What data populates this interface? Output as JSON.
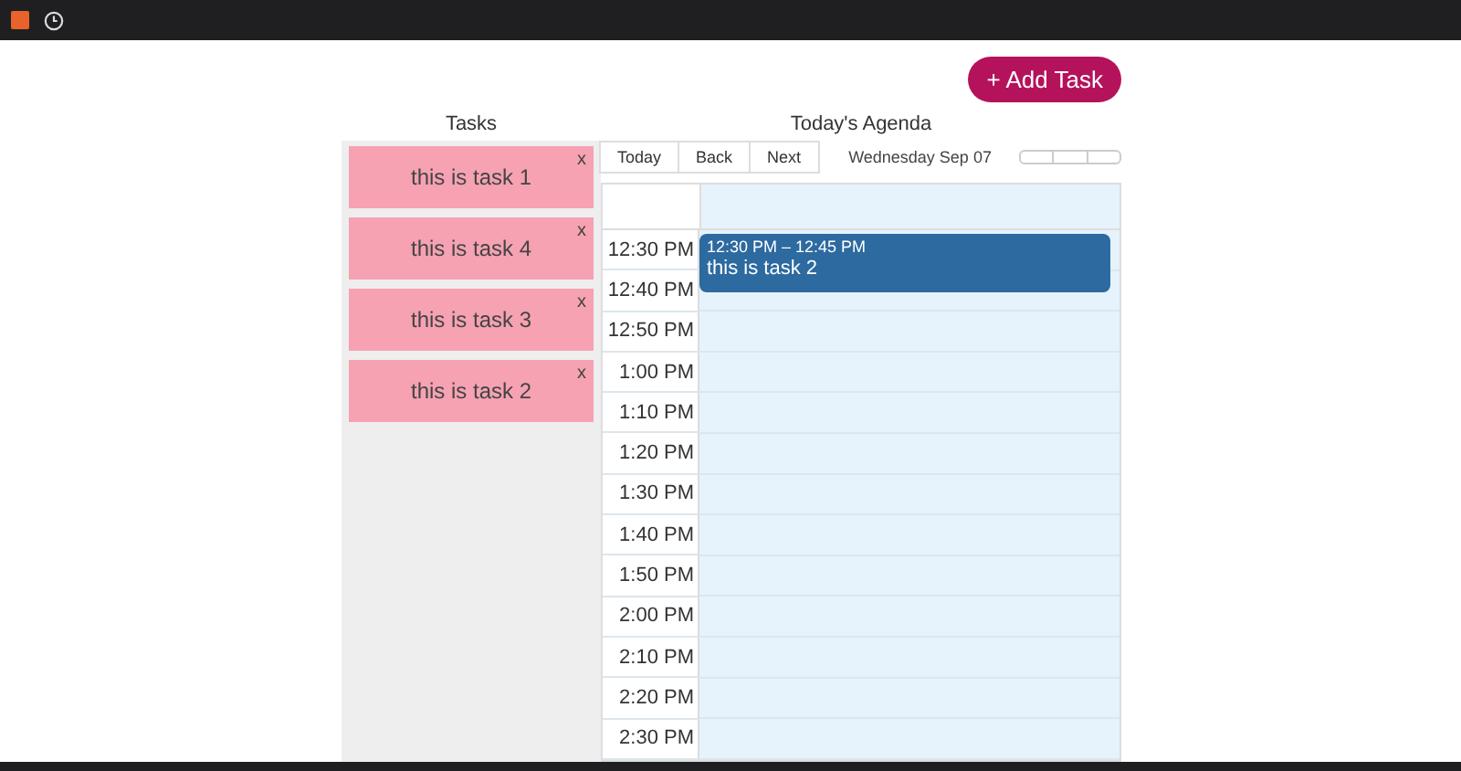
{
  "add_button": {
    "label": "+ Add Task"
  },
  "tasks": {
    "title": "Tasks",
    "items": [
      {
        "label": "this is task 1",
        "remove": "x"
      },
      {
        "label": "this is task 4",
        "remove": "x"
      },
      {
        "label": "this is task 3",
        "remove": "x"
      },
      {
        "label": "this is task 2",
        "remove": "x"
      }
    ]
  },
  "agenda": {
    "title": "Today's Agenda",
    "nav": [
      "Today",
      "Back",
      "Next"
    ],
    "date": "Wednesday Sep 07",
    "slots": [
      "12:30 PM",
      "12:40 PM",
      "12:50 PM",
      "1:00 PM",
      "1:10 PM",
      "1:20 PM",
      "1:30 PM",
      "1:40 PM",
      "1:50 PM",
      "2:00 PM",
      "2:10 PM",
      "2:20 PM",
      "2:30 PM"
    ],
    "events": [
      {
        "time": "12:30 PM – 12:45 PM",
        "title": "this is task 2"
      }
    ]
  }
}
